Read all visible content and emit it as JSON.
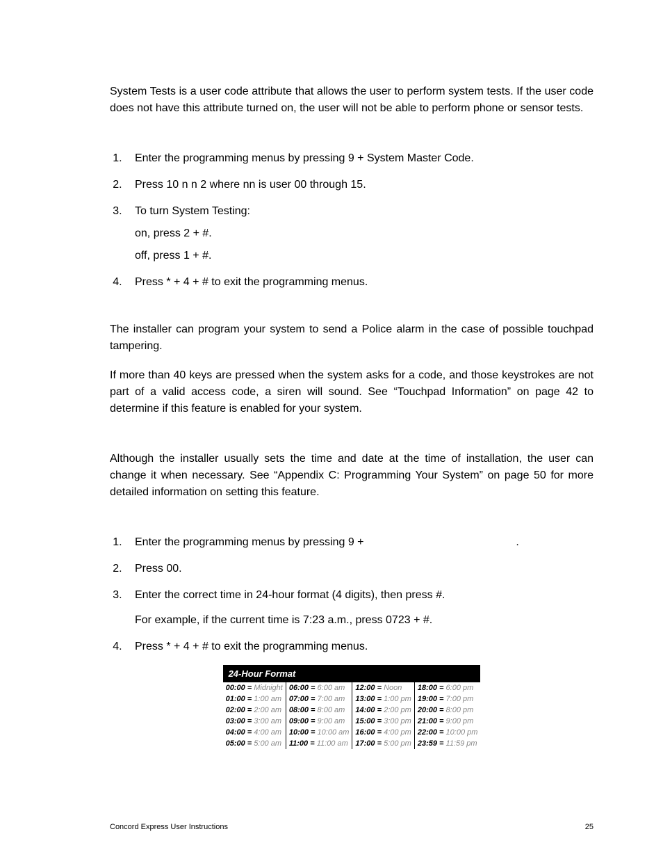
{
  "intro": "System Tests is a user code attribute that allows the user to perform system tests. If the user code does not have this attribute turned on, the user will not be able to perform phone or sensor tests.",
  "list1": {
    "i1": "Enter the programming menus by pressing 9 + System Master Code.",
    "i2": "Press 10 n n 2 where nn is user 00 through 15.",
    "i3": "To turn System Testing:",
    "i3a": "on, press 2 + #.",
    "i3b": "off, press 1 + #.",
    "i4": "Press * + 4 + # to exit the programming menus."
  },
  "para2": "The installer can program your system to send a Police alarm in the case of possible touchpad tampering.",
  "para3": "If more than 40 keys are pressed when the system asks for a code, and those keystrokes are not part of a valid access code, a siren will sound. See “Touchpad Information” on page 42 to determine if this feature is enabled for your system.",
  "para4": "Although the installer usually sets the time and date at the time of installation, the user can change it when necessary. See “Appendix C: Programming Your System” on page 50 for more detailed information on setting this feature.",
  "list2": {
    "i1a": "Enter the programming menus by pressing 9 + ",
    "i1b": ".",
    "i2": "Press 00.",
    "i3": "Enter the correct time in 24-hour format (4 digits), then press #.",
    "i3a": "For example, if the current time is 7:23 a.m., press 0723 + #.",
    "i4": "Press * + 4 + # to exit the programming menus."
  },
  "table": {
    "header": "24-Hour Format",
    "rows": [
      [
        {
          "h": "00:00",
          "t": "Midnight"
        },
        {
          "h": "06:00",
          "t": "6:00 am"
        },
        {
          "h": "12:00",
          "t": "Noon"
        },
        {
          "h": "18:00",
          "t": "6:00 pm"
        }
      ],
      [
        {
          "h": "01:00",
          "t": "1:00 am"
        },
        {
          "h": "07:00",
          "t": "7:00 am"
        },
        {
          "h": "13:00",
          "t": "1:00 pm"
        },
        {
          "h": "19:00",
          "t": "7:00 pm"
        }
      ],
      [
        {
          "h": "02:00",
          "t": "2:00 am"
        },
        {
          "h": "08:00",
          "t": "8:00 am"
        },
        {
          "h": "14:00",
          "t": "2:00 pm"
        },
        {
          "h": "20:00",
          "t": "8:00 pm"
        }
      ],
      [
        {
          "h": "03:00",
          "t": "3:00 am"
        },
        {
          "h": "09:00",
          "t": "9:00 am"
        },
        {
          "h": "15:00",
          "t": "3:00 pm"
        },
        {
          "h": "21:00",
          "t": "9:00 pm"
        }
      ],
      [
        {
          "h": "04:00",
          "t": "4:00 am"
        },
        {
          "h": "10:00",
          "t": "10:00 am"
        },
        {
          "h": "16:00",
          "t": "4:00 pm"
        },
        {
          "h": "22:00",
          "t": "10:00 pm"
        }
      ],
      [
        {
          "h": "05:00",
          "t": "5:00 am"
        },
        {
          "h": "11:00",
          "t": "11:00 am"
        },
        {
          "h": "17:00",
          "t": "5:00 pm"
        },
        {
          "h": "23:59",
          "t": "11:59 pm"
        }
      ]
    ]
  },
  "footer": {
    "title": "Concord Express User Instructions",
    "page": "25"
  }
}
